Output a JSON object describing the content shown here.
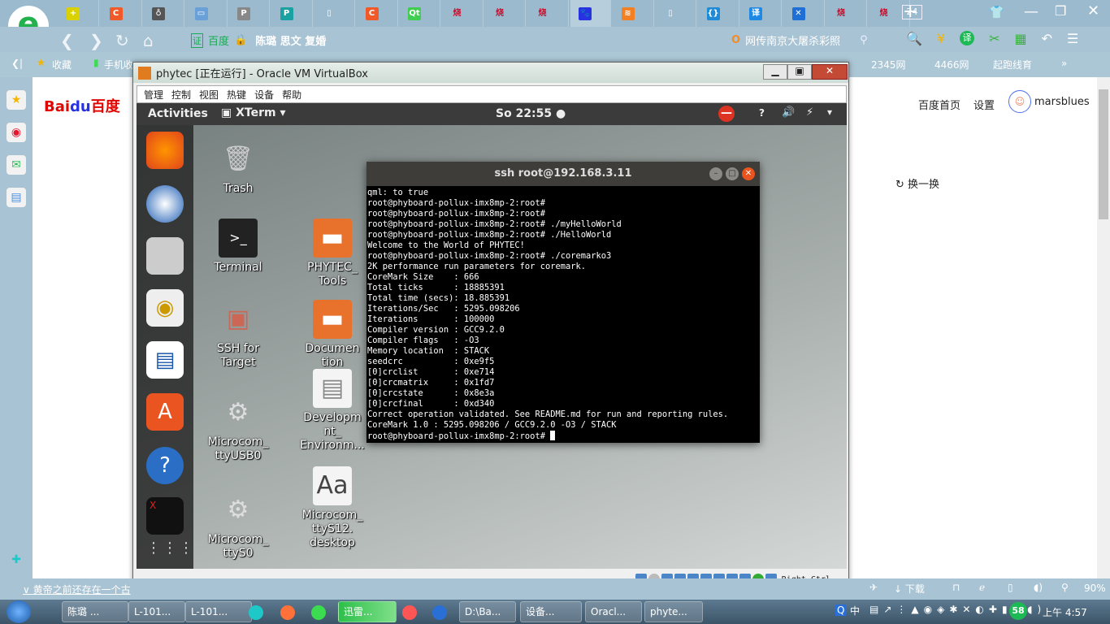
{
  "browser": {
    "tabs": [
      {
        "icon": "+",
        "color": "#d9d100"
      },
      {
        "icon": "C",
        "color": "#f05a28"
      },
      {
        "icon": "♁",
        "color": "#555"
      },
      {
        "icon": "▭",
        "color": "#6aa0d8"
      },
      {
        "icon": "P",
        "color": "#888"
      },
      {
        "icon": "P",
        "color": "#1ba1a1"
      },
      {
        "icon": "▯",
        "color": "#eee"
      },
      {
        "icon": "C",
        "color": "#f05a28"
      },
      {
        "icon": "Qt",
        "color": "#41cd52"
      },
      {
        "icon": "烧",
        "color": "#c8102e"
      },
      {
        "icon": "烧",
        "color": "#c8102e"
      },
      {
        "icon": "烧",
        "color": "#c8102e"
      },
      {
        "icon": "🐾",
        "color": "#2932e1"
      },
      {
        "icon": "≋",
        "color": "#f48024"
      },
      {
        "icon": "▯",
        "color": "#eee"
      },
      {
        "icon": "{}",
        "color": "#1f8ad6"
      },
      {
        "icon": "译",
        "color": "#1e88e5"
      },
      {
        "icon": "✕",
        "color": "#1e6fd6"
      },
      {
        "icon": "烧",
        "color": "#c8102e"
      },
      {
        "icon": "烧",
        "color": "#c8102e"
      }
    ],
    "new_tab": "+",
    "tab_count": "24",
    "address": {
      "cert": "证",
      "site": "百度",
      "title": "陈璐 思文 复婚"
    },
    "search_text": "网传南京大屠杀彩照",
    "bookmarks": {
      "favorites": "收藏",
      "mobile": "手机收",
      "items": [
        "2345网",
        "4466网",
        "起跑线育"
      ],
      "more": "»"
    },
    "status": {
      "news": "黄帝之前还存在一个古",
      "download": "下载",
      "zoom": "90%"
    }
  },
  "baidu": {
    "logo": "Bai百度",
    "home": "百度首页",
    "settings": "设置",
    "user": "marsblues",
    "refresh": "换一换"
  },
  "vbox": {
    "title": "phytec [正在运行] - Oracle VM VirtualBox",
    "menu": [
      "管理",
      "控制",
      "视图",
      "热键",
      "设备",
      "帮助"
    ],
    "host_key": "Right Ctrl",
    "ubuntu": {
      "activities": "Activities",
      "app": "XTerm",
      "clock": "So 22:55"
    },
    "desktop": [
      {
        "label": "Trash",
        "icon": "trash"
      },
      {
        "label": "Terminal",
        "icon": "terminal"
      },
      {
        "label": "PHYTEC_ Tools",
        "icon": "folder"
      },
      {
        "label": "SSH for Target",
        "icon": "monitor"
      },
      {
        "label": "Documen tion",
        "icon": "folder"
      },
      {
        "label": "Microcom_ ttyUSB0",
        "icon": "gear"
      },
      {
        "label": "Developm nt_ Environm...",
        "icon": "document"
      },
      {
        "label": "Microcom_ ttyS0",
        "icon": "gear"
      },
      {
        "label": "Microcom_ ttyS12. desktop",
        "icon": "font-document"
      }
    ]
  },
  "terminal": {
    "title": "ssh root@192.168.3.11",
    "lines": [
      "qml: to true",
      "root@phyboard-pollux-imx8mp-2:root#",
      "root@phyboard-pollux-imx8mp-2:root#",
      "root@phyboard-pollux-imx8mp-2:root# ./myHelloWorld",
      "root@phyboard-pollux-imx8mp-2:root# ./HelloWorld",
      "Welcome to the World of PHYTEC!",
      "root@phyboard-pollux-imx8mp-2:root# ./coremarko3",
      "2K performance run parameters for coremark.",
      "CoreMark Size    : 666",
      "Total ticks      : 18885391",
      "Total time (secs): 18.885391",
      "Iterations/Sec   : 5295.098206",
      "Iterations       : 100000",
      "Compiler version : GCC9.2.0",
      "Compiler flags   : -O3",
      "Memory location  : STACK",
      "seedcrc          : 0xe9f5",
      "[0]crclist       : 0xe714",
      "[0]crcmatrix     : 0x1fd7",
      "[0]crcstate      : 0x8e3a",
      "[0]crcfinal      : 0xd340",
      "Correct operation validated. See README.md for run and reporting rules.",
      "CoreMark 1.0 : 5295.098206 / GCC9.2.0 -O3 / STACK"
    ],
    "prompt": "root@phyboard-pollux-imx8mp-2:root# "
  },
  "taskbar": {
    "items": [
      "陈璐 ...",
      "L-101...",
      "L-101...",
      "迅雷...",
      "D:\\Ba...",
      "设备...",
      "Oracl...",
      "phyte..."
    ],
    "badge": "58",
    "ime": "中",
    "time": "上午 4:57"
  }
}
